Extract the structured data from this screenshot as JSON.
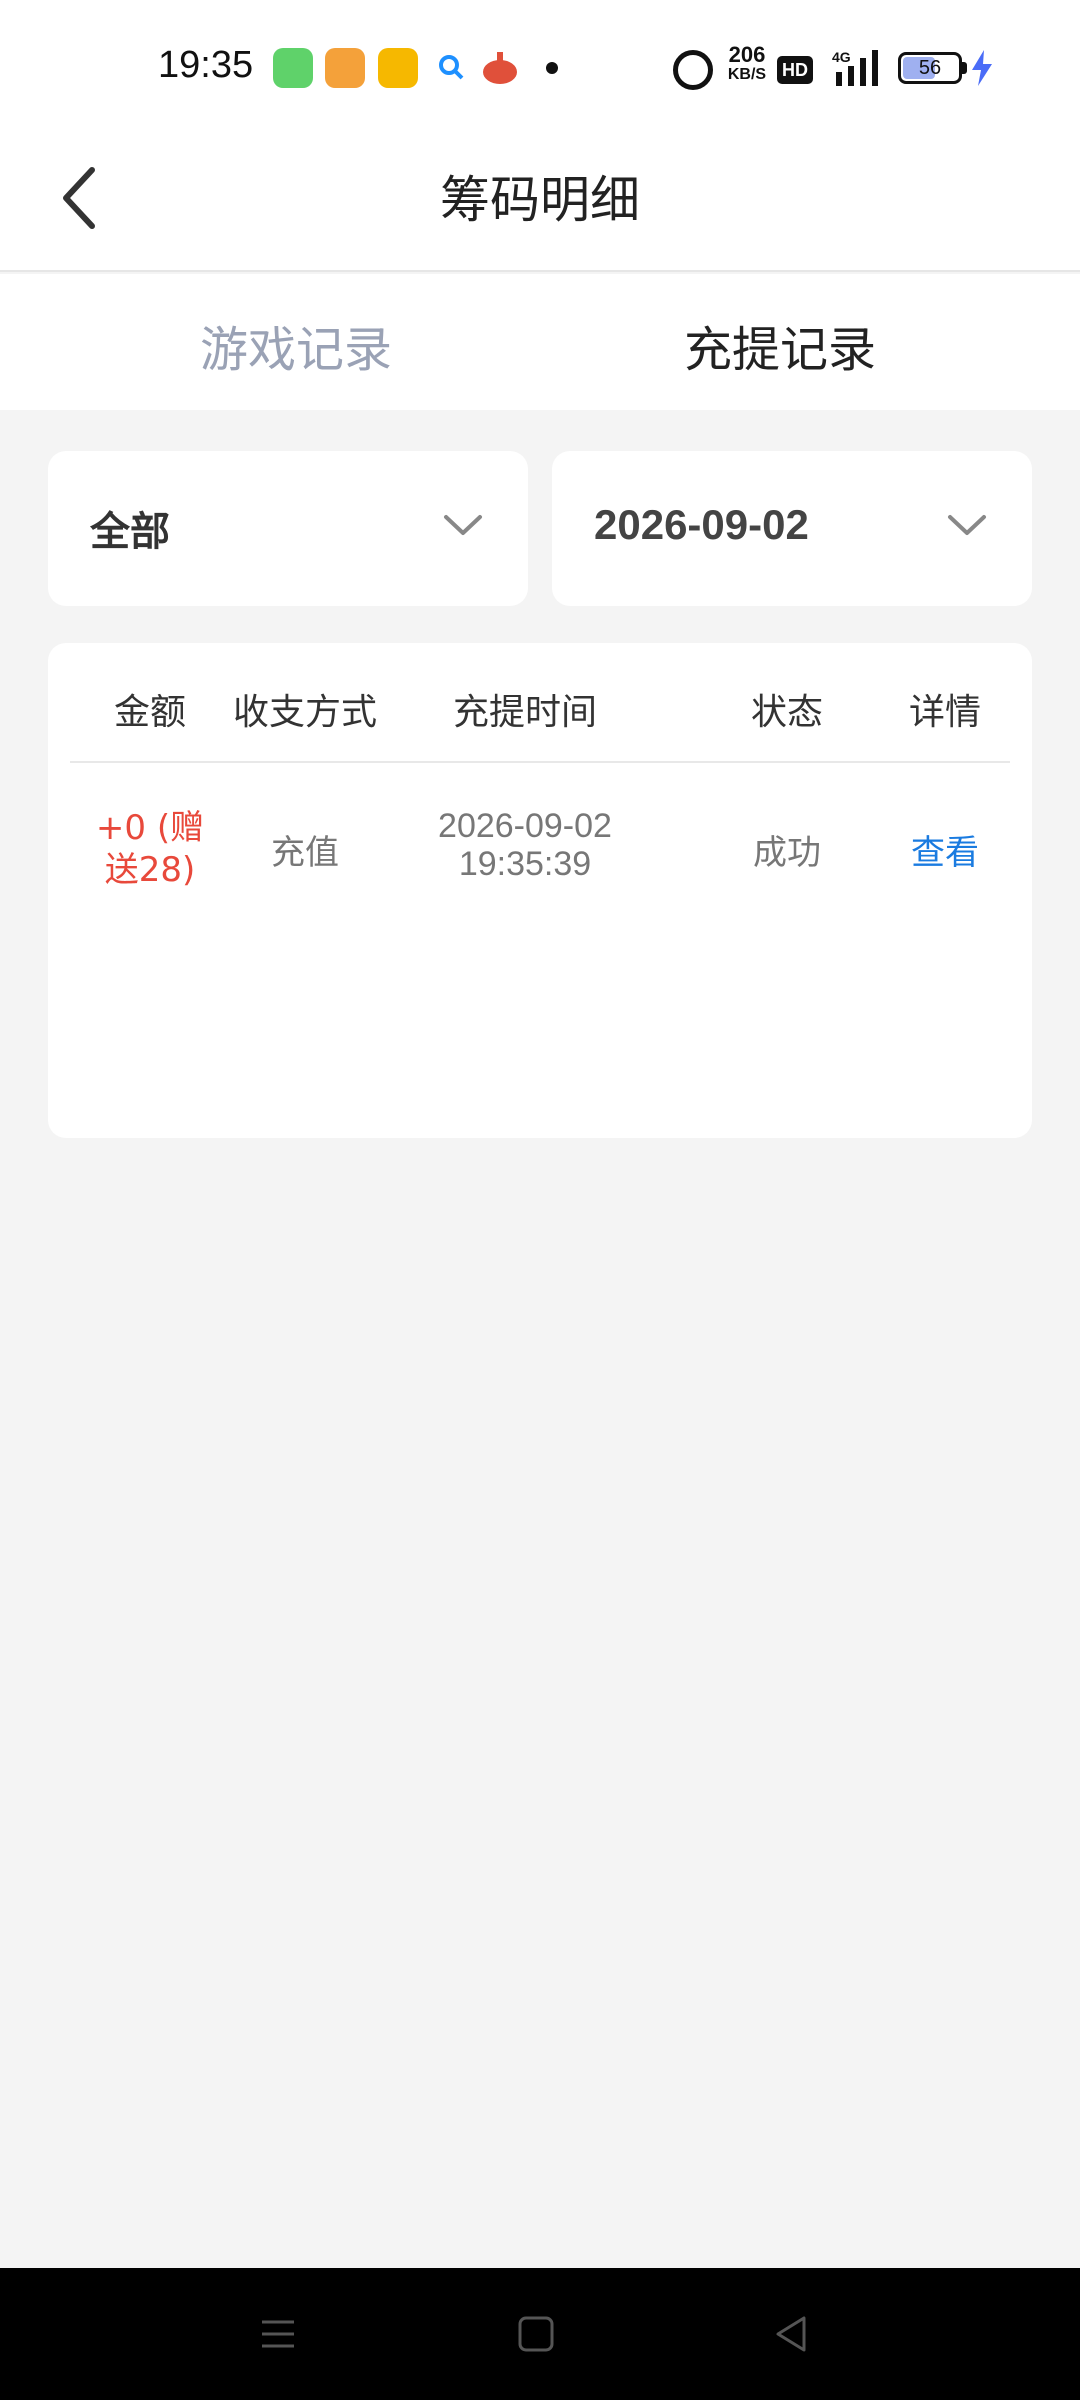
{
  "status_bar": {
    "time": "19:35",
    "speed_value": "206",
    "speed_unit": "KB/S",
    "hd": "HD",
    "network": "4G",
    "battery": "56"
  },
  "header": {
    "title": "筹码明细"
  },
  "tabs": {
    "game": "游戏记录",
    "recharge": "充提记录"
  },
  "filters": {
    "type": "全部",
    "date": "2026-09-02"
  },
  "table": {
    "headers": [
      "金额",
      "收支方式",
      "充提时间",
      "状态",
      "详情"
    ],
    "rows": [
      {
        "amount_line1": "+0 (赠",
        "amount_line2": "送28)",
        "method": "充值",
        "date": "2026-09-02",
        "time": "19:35:39",
        "status": "成功",
        "detail": "查看"
      }
    ]
  },
  "colors": {
    "amount": "#e8493b",
    "link": "#1a7be0",
    "inactive_tab": "#9aa2b5",
    "background": "#f4f4f4"
  }
}
